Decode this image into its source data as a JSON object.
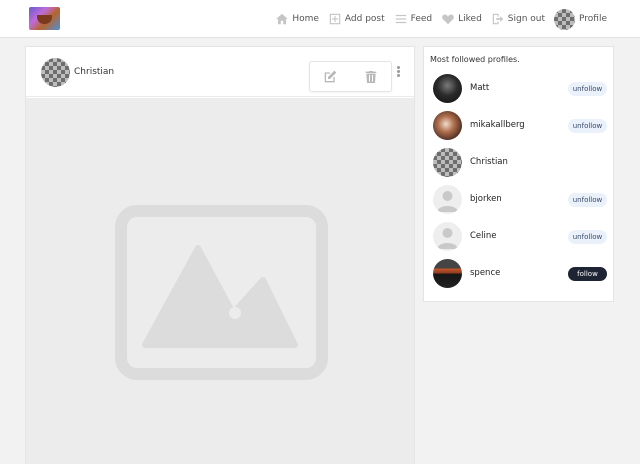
{
  "navbar": {
    "logo": "app-logo",
    "links": [
      {
        "label": "Home",
        "icon": "home-icon"
      },
      {
        "label": "Add post",
        "icon": "add-post-icon"
      },
      {
        "label": "Feed",
        "icon": "feed-icon"
      },
      {
        "label": "Liked",
        "icon": "heart-icon"
      },
      {
        "label": "Sign out",
        "icon": "sign-out-icon"
      },
      {
        "label": "Profile",
        "icon": "avatar"
      }
    ]
  },
  "post": {
    "author": "Christian",
    "actions": {
      "edit_icon": "edit-icon",
      "delete_icon": "trash-icon",
      "menu_icon": "more-vertical-icon"
    },
    "image_icon": "image-placeholder-icon"
  },
  "sidebar": {
    "title": "Most followed profiles.",
    "profiles": [
      {
        "name": "Matt",
        "button": "unfollow"
      },
      {
        "name": "mikakallberg",
        "button": "unfollow"
      },
      {
        "name": "Christian",
        "button": ""
      },
      {
        "name": "bjorken",
        "button": "unfollow"
      },
      {
        "name": "Celine",
        "button": "unfollow"
      },
      {
        "name": "spence",
        "button": "follow"
      }
    ]
  },
  "colors": {
    "background": "#f2f2f2",
    "card": "#ffffff",
    "unfollow_pill": "#eaf1fb",
    "follow_pill": "#1e2433",
    "icon_grey": "#c6c6c6"
  }
}
